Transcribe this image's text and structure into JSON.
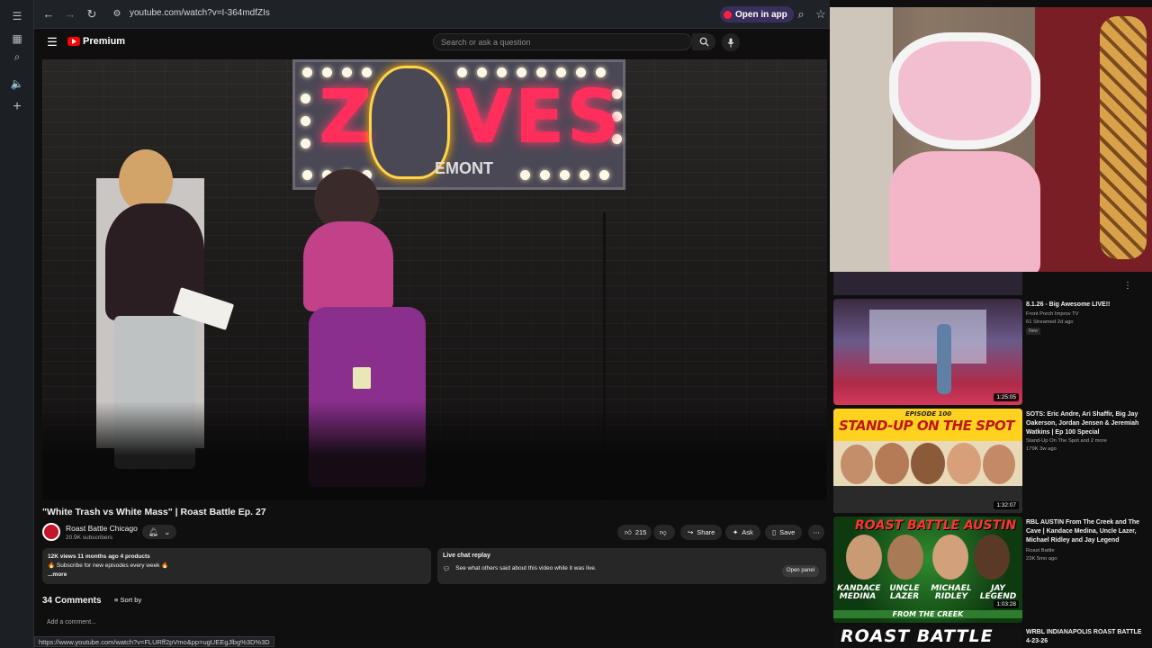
{
  "browser": {
    "url": "youtube.com/watch?v=I-364mdfZIs",
    "open_in_app": "Open in app",
    "status_url": "https://www.youtube.com/watch?v=FLURff2pVmo&pp=ugUEEgJlbg%3D%3D"
  },
  "youtube": {
    "brand": "Premium",
    "search_placeholder": "Search or ask a question"
  },
  "video": {
    "sign_word": "ZOMBIES",
    "sign_sub": "EMONT",
    "title": "\"White Trash vs White Mass\" | Roast Battle Ep. 27",
    "channel": "Roast Battle Chicago",
    "subscribers": "20.9K subscribers",
    "likes": "215",
    "share": "Share",
    "ask": "Ask",
    "save": "Save",
    "views_line": "12K views  11 months ago  4 products",
    "desc_line": "🔥 Subscribe for new episodes every week 🔥",
    "more": "...more",
    "chat_title": "Live chat replay",
    "chat_desc": "See what others said about this video while it was live.",
    "open_panel": "Open panel",
    "comments_count": "34 Comments",
    "sort_by": "Sort by",
    "add_comment": "Add a comment..."
  },
  "related": [
    {
      "title": "8.1.26 - Big Awesome LIVE!!",
      "channel": "Front Porch Improv TV",
      "meta": "61  Streamed 2d ago",
      "badge": "New",
      "duration": "1:25:05"
    },
    {
      "title": "SOTS: Eric Andre, Ari Shaffir, Big Jay Oakerson, Jordan Jensen & Jeremiah Watkins | Ep 100 Special",
      "channel": "Stand-Up On The Spot and 2 more",
      "meta": "179K  3w ago",
      "thumb_top": "EPISODE 100",
      "thumb_main": "STAND-UP ON THE SPOT",
      "duration": "1:32:07"
    },
    {
      "title": "RBL AUSTIN From The Creek and The Cave | Kandace Medina, Uncle Lazer, Michael Ridley and Jay Legend",
      "channel": "Roast Battle",
      "meta": "23K  5mo ago",
      "thumb_top": "ROAST BATTLE AUSTIN",
      "names": [
        "KANDACE MEDINA",
        "UNCLE LAZER",
        "MICHAEL RIDLEY",
        "JAY LEGEND"
      ],
      "thumb_bottom": "FROM THE CREEK",
      "duration": "1:03:28"
    },
    {
      "title": "WRBL INDIANAPOLIS ROAST BATTLE 4-23-26",
      "thumb_main": "ROAST BATTLE"
    }
  ],
  "colors": {
    "brand_red": "#ff0000",
    "sign_pink": "#ff2e5b",
    "thumb_yellow": "#ffd21f",
    "thumb_green": "#2e8b2e"
  }
}
